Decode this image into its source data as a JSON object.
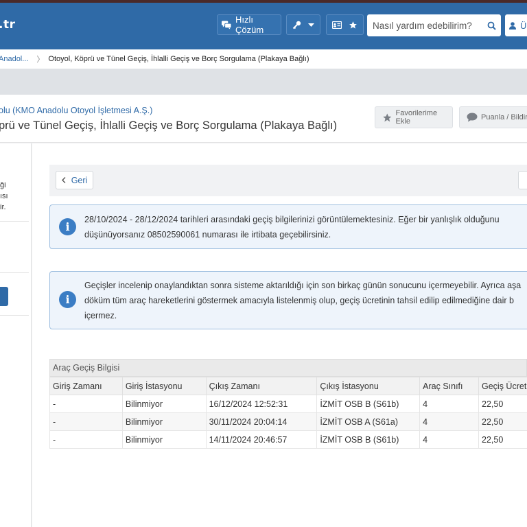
{
  "header": {
    "logo_text": ".tr",
    "quick_solution_label": "Hızlı Çözüm",
    "search_placeholder": "Nasıl yardım edebilirim?",
    "user_label": "Ü",
    "colors": {
      "header_bg": "#2f6aa7",
      "accent": "#3b7dc4"
    }
  },
  "breadcrumb": {
    "items": [
      "Anadol...",
      "Otoyol, Köprü ve Tünel Geçiş, İhlalli Geçiş ve Borç Sorgulama (Plakaya Bağlı)"
    ]
  },
  "page": {
    "subtitle": "olu (KMO Anadolu Otoyol İşletmesi A.Ş.)",
    "title": "prü ve Tünel Geçiş, İhlalli Geçiş ve Borç Sorgulama (Plakaya Bağlı)",
    "favorites_label": "Favorilerime Ekle",
    "rate_label": "Puanla / Bildir"
  },
  "sidebar": {
    "text_lines": [
      "ği",
      "ısı",
      "ir."
    ]
  },
  "toolbar": {
    "back_label": "Geri"
  },
  "alerts": {
    "first_line1": "28/10/2024 - 28/12/2024 tarihleri arasındaki geçiş bilgilerinizi görüntülemektesiniz. Eğer bir yanlışlık olduğunu",
    "first_line2": "düşünüyorsanız 08502590061 numarası ile irtibata geçebilirsiniz.",
    "second_line1": "Geçişler incelenip onaylandıktan sonra sisteme aktarıldığı için son birkaç günün sonucunu içermeyebilir. Ayrıca aşa",
    "second_line2": "döküm tüm araç hareketlerini göstermek amacıyla listelenmiş olup, geçiş ücretinin tahsil edilip edilmediğine dair b",
    "second_line3": "içermez."
  },
  "table": {
    "caption": "Araç Geçiş Bilgisi",
    "headers": [
      "Giriş Zamanı",
      "Giriş İstasyonu",
      "Çıkış Zamanı",
      "Çıkış İstasyonu",
      "Araç Sınıfı",
      "Geçiş Ücret"
    ],
    "rows": [
      [
        "-",
        "Bilinmiyor",
        "16/12/2024 12:52:31",
        "İZMİT OSB B (S61b)",
        "4",
        "22,50"
      ],
      [
        "-",
        "Bilinmiyor",
        "30/11/2024 20:04:14",
        "İZMİT OSB A (S61a)",
        "4",
        "22,50"
      ],
      [
        "-",
        "Bilinmiyor",
        "14/11/2024 20:46:57",
        "İZMİT OSB B (S61b)",
        "4",
        "22,50"
      ]
    ]
  }
}
